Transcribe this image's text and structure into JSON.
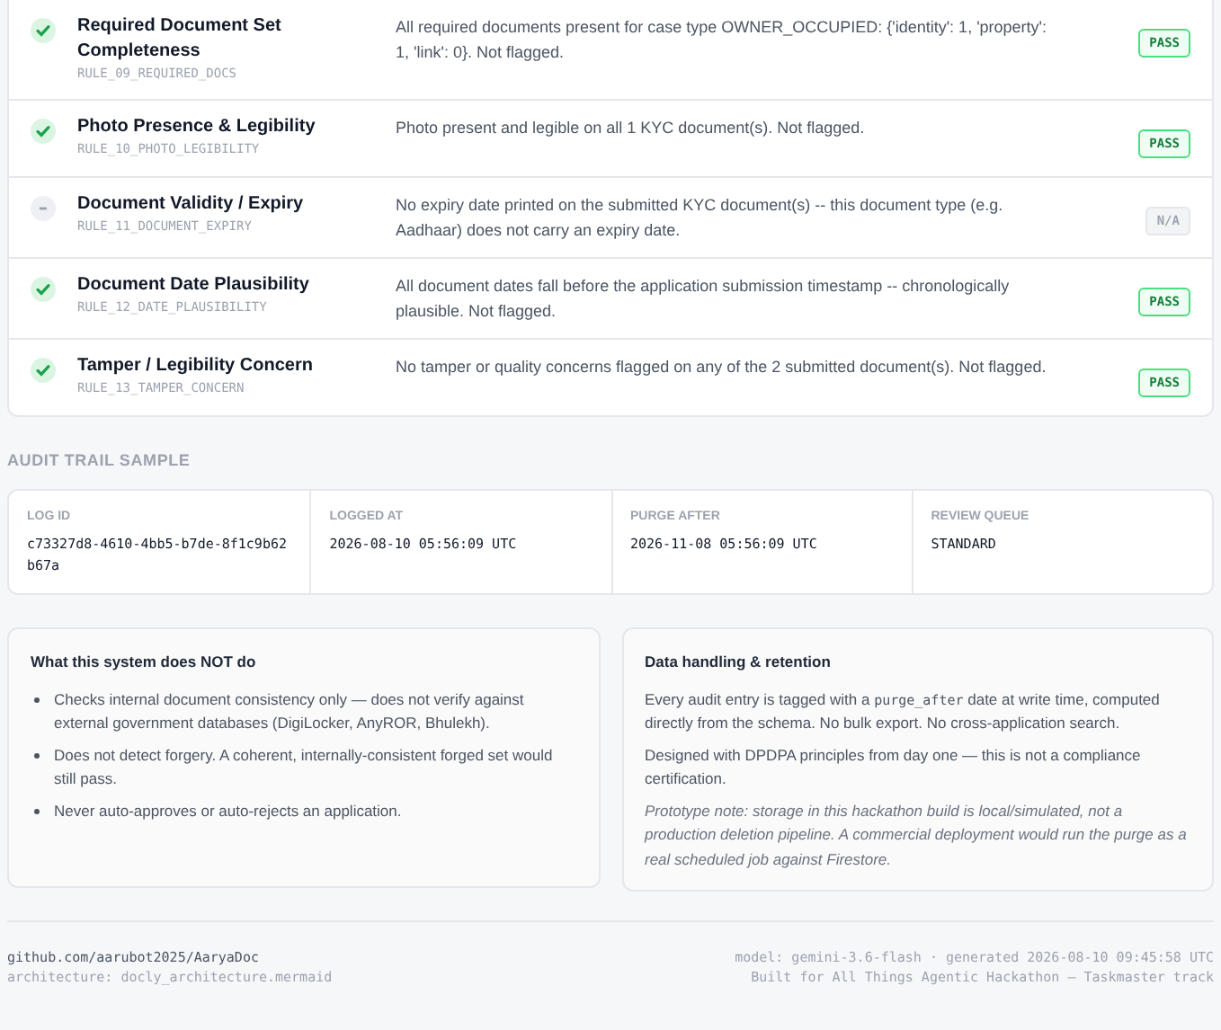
{
  "rules": [
    {
      "kind": "pass",
      "title": "Required Document Set Completeness",
      "code": "RULE_09_REQUIRED_DOCS",
      "detail": "All required documents present for case type OWNER_OCCUPIED: {'identity': 1, 'property': 1, 'link': 0}. Not flagged.",
      "badge": "PASS"
    },
    {
      "kind": "pass",
      "title": "Photo Presence & Legibility",
      "code": "RULE_10_PHOTO_LEGIBILITY",
      "detail": "Photo present and legible on all 1 KYC document(s). Not flagged.",
      "badge": "PASS"
    },
    {
      "kind": "na",
      "title": "Document Validity / Expiry",
      "code": "RULE_11_DOCUMENT_EXPIRY",
      "detail": "No expiry date printed on the submitted KYC document(s) -- this document type (e.g. Aadhaar) does not carry an expiry date.",
      "badge": "N/A"
    },
    {
      "kind": "pass",
      "title": "Document Date Plausibility",
      "code": "RULE_12_DATE_PLAUSIBILITY",
      "detail": "All document dates fall before the application submission timestamp -- chronologically plausible. Not flagged.",
      "badge": "PASS"
    },
    {
      "kind": "pass",
      "title": "Tamper / Legibility Concern",
      "code": "RULE_13_TAMPER_CONCERN",
      "detail": "No tamper or quality concerns flagged on any of the 2 submitted document(s). Not flagged.",
      "badge": "PASS"
    }
  ],
  "audit": {
    "heading": "AUDIT TRAIL SAMPLE",
    "fields": [
      {
        "label": "LOG ID",
        "value": "c73327d8-4610-4bb5-b7de-8f1c9b62b67a"
      },
      {
        "label": "LOGGED AT",
        "value": "2026-08-10 05:56:09 UTC"
      },
      {
        "label": "PURGE AFTER",
        "value": "2026-11-08 05:56:09 UTC"
      },
      {
        "label": "REVIEW QUEUE",
        "value": "STANDARD"
      }
    ]
  },
  "limits": {
    "title": "What this system does NOT do",
    "items": [
      "Checks internal document consistency only — does not verify against external government databases (DigiLocker, AnyROR, Bhulekh).",
      "Does not detect forgery. A coherent, internally-consistent forged set would still pass.",
      "Never auto-approves or auto-rejects an application."
    ]
  },
  "retention": {
    "title": "Data handling & retention",
    "para1_before": "Every audit entry is tagged with a ",
    "para1_code": "purge_after",
    "para1_after": " date at write time, computed directly from the schema. No bulk export. No cross-application search.",
    "para2": "Designed with DPDPA principles from day one — this is not a compliance certification.",
    "note": "Prototype note: storage in this hackathon build is local/simulated, not a production deletion pipeline. A commercial deployment would run the purge as a real scheduled job against Firestore."
  },
  "footer": {
    "repo": "github.com/aarubot2025/AaryaDoc",
    "architecture": "architecture: docly_architecture.mermaid",
    "model": "model: gemini-3.6-flash · generated 2026-08-10 09:45:58 UTC",
    "credit": "Built for All Things Agentic Hackathon — Taskmaster track"
  }
}
